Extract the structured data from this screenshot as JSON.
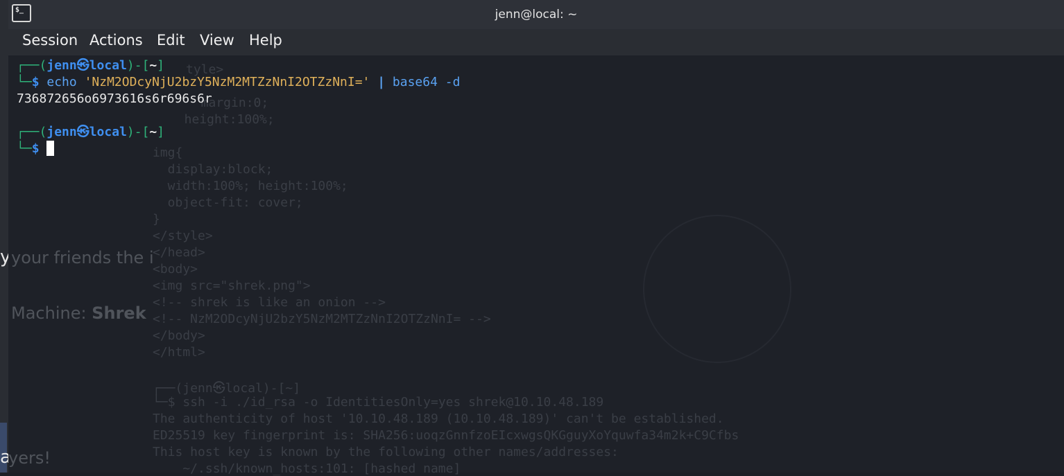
{
  "window": {
    "title": "jenn@local: ~"
  },
  "menu": [
    "Session",
    "Actions",
    "Edit",
    "View",
    "Help"
  ],
  "prompt": {
    "user": "jenn",
    "at": "㉿",
    "host": "local",
    "dir": "~",
    "symbol": "$"
  },
  "terminal": {
    "command1": {
      "cmd": "echo",
      "arg": "'NzM2ODcyNjU2bzY5NzM2MTZzNnI2OTZzNnI='",
      "pipe": "|",
      "cmd2": "base64",
      "flag": "-d"
    },
    "output1": "736872656o6973616s6r696s6r"
  },
  "background_left": {
    "text1": "y",
    "text2": "a"
  },
  "ghost_text": {
    "lines": [
      "tyle>",
      "  margin:0;",
      "  height:100%;",
      "img{",
      "  display:block;",
      "  width:100%; height:100%;",
      "  object-fit: cover;",
      "}",
      "</style>",
      "</head>",
      "<body>",
      "<img src=\"shrek.png\">",
      "<!-- shrek is like an onion -->",
      "<!-- NzM2ODcyNjU2bzY5NzM2MTZzNnI2OTZzNnI= -->",
      "</body>",
      "</html>"
    ],
    "prompt_user": "jenn",
    "prompt_host": "local",
    "prompt_dir": "~",
    "ssh_cmd": "$ ssh -i ./id_rsa -o IdentitiesOnly=yes shrek@10.10.48.189",
    "ssh_line1": "The authenticity of host '10.10.48.189 (10.10.48.189)' can't be established.",
    "ssh_line2": "ED25519 key fingerprint is: SHA256:uoqzGnnfzoEIcxwgsQKGguyXoYquwfa34m2k+C9Cfbs",
    "ssh_line3": "This host key is known by the following other names/addresses:",
    "ssh_line4": "    ~/.ssh/known_hosts:101: [hashed name]",
    "page_text1": "your friends the i",
    "page_text2_label": "Machine:",
    "page_text2_value": "Shrek",
    "page_text3": "yers!"
  },
  "colors": {
    "prompt_frame": "#2fb37a",
    "prompt_user": "#3f8ff0",
    "command": "#5aa2f2",
    "string": "#e0b15a",
    "output": "#e8e8e8",
    "titlebar": "#2e3138",
    "menubar": "#2a2d33",
    "terminal_bg": "#1e2128"
  }
}
